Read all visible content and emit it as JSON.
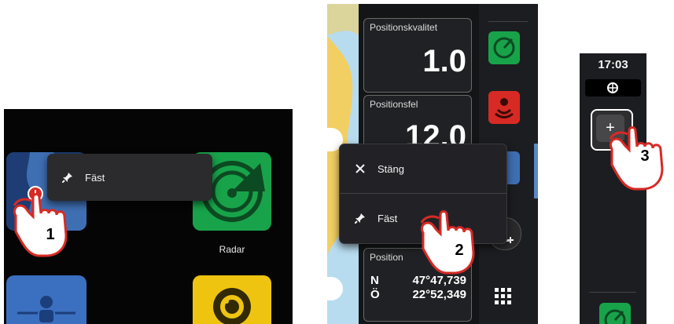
{
  "panel1": {
    "popup": {
      "pin_label": "Fäst"
    },
    "radar_label": "Radar",
    "step": "1"
  },
  "panel2": {
    "cards": [
      {
        "label": "Positionskvalitet",
        "value": "1.0"
      },
      {
        "label": "Positionsfel",
        "value": "12.0"
      }
    ],
    "position": {
      "label": "Position",
      "lat_prefix": "N",
      "lat_value": "47°47,739",
      "lon_prefix": "Ö",
      "lon_value": "22°52,349"
    },
    "popup": {
      "close_label": "Stäng",
      "pin_label": "Fäst"
    },
    "step": "2"
  },
  "panel3": {
    "clock": "17:03",
    "add_glyph": "+",
    "step": "3"
  },
  "colors": {
    "accent_red": "#d72a25",
    "radar_green": "#18a34a",
    "chart_blue": "#3f6fb3",
    "camera_yellow": "#efc411"
  }
}
